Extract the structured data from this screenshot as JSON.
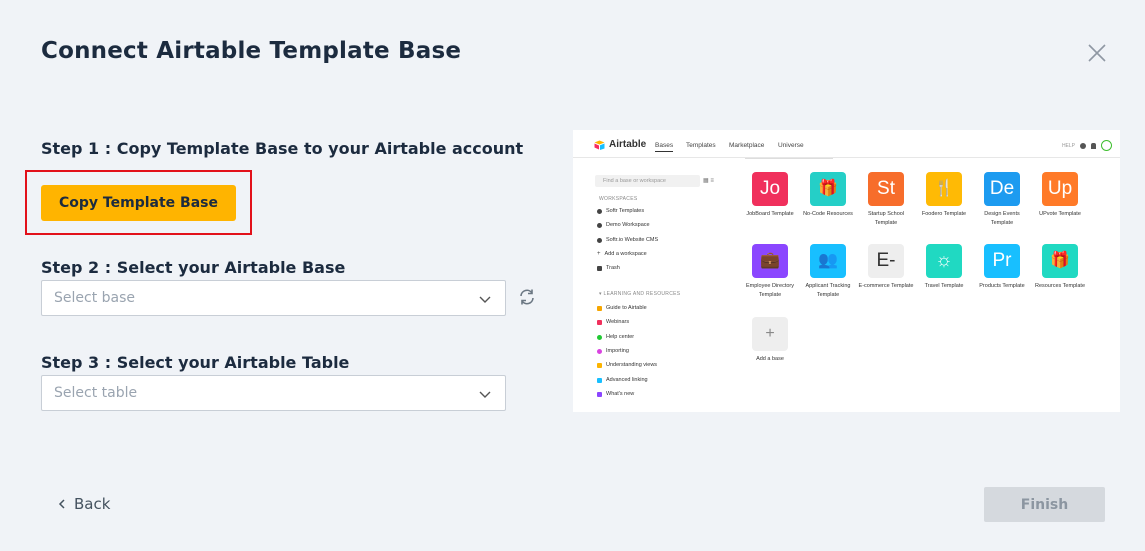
{
  "dialog": {
    "title": "Connect Airtable Template Base",
    "step1": "Step 1 : Copy Template Base to your Airtable account",
    "copy_button": "Copy Template Base",
    "step2": "Step 2 : Select your Airtable Base",
    "base_placeholder": "Select base",
    "step3": "Step 3 : Select your Airtable Table",
    "table_placeholder": "Select table",
    "back": "Back",
    "finish": "Finish"
  },
  "preview": {
    "logo": "Airtable",
    "nav": [
      "Bases",
      "Templates",
      "Marketplace",
      "Universe"
    ],
    "help": "HELP",
    "search_placeholder": "Find a base or workspace",
    "workspaces_label": "WORKSPACES",
    "workspaces": [
      "Softr Templates",
      "Demo Workspace",
      "Softr.io Website CMS",
      "Add a workspace",
      "Trash"
    ],
    "learning_label": "LEARNING AND RESOURCES",
    "learning": [
      "Guide to Airtable",
      "Webinars",
      "Help center",
      "Importing",
      "Understanding views",
      "Advanced linking",
      "What's new"
    ],
    "bases": [
      {
        "abbr": "Jo",
        "name": "JobBoard Template",
        "color": "#f0305c"
      },
      {
        "abbr": "🎁",
        "name": "No-Code Resources",
        "color": "#25cfc7"
      },
      {
        "abbr": "St",
        "name": "Startup School Template",
        "color": "#f76d2b"
      },
      {
        "abbr": "🍴",
        "name": "Foodero Template",
        "color": "#ffba05"
      },
      {
        "abbr": "De",
        "name": "Design Events Template",
        "color": "#1d9bf0"
      },
      {
        "abbr": "Up",
        "name": "UPvote Template",
        "color": "#ff7a28"
      },
      {
        "abbr": "💼",
        "name": "Employee Directory Template",
        "color": "#8b46ff"
      },
      {
        "abbr": "👥",
        "name": "Applicant Tracking Template",
        "color": "#18bfff"
      },
      {
        "abbr": "E-",
        "name": "E-commerce Template",
        "color": "#eeeeee"
      },
      {
        "abbr": "☼",
        "name": "Travel Template",
        "color": "#20d9c2"
      },
      {
        "abbr": "Pr",
        "name": "Products Template",
        "color": "#18bfff"
      },
      {
        "abbr": "🎁",
        "name": "Resources Template",
        "color": "#20d9c2"
      },
      {
        "abbr": "+",
        "name": "Add a base",
        "color": "#eeeeee"
      }
    ]
  },
  "colors": {
    "accent": "#ffb400",
    "highlight": "#e2101a",
    "disabled": "#d5d9de"
  }
}
